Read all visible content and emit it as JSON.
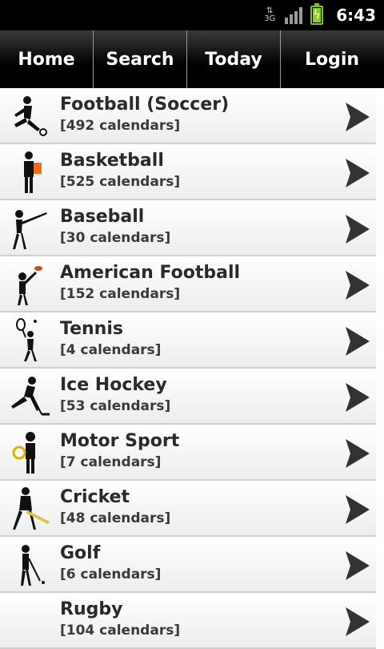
{
  "status": {
    "time": "6:43",
    "network": "3G",
    "icons": [
      "data-arrows-icon",
      "signal-icon",
      "battery-charging-icon"
    ]
  },
  "nav": [
    {
      "label": "Home"
    },
    {
      "label": "Search"
    },
    {
      "label": "Today"
    },
    {
      "label": "Login"
    }
  ],
  "sports": [
    {
      "title": "Football (Soccer)",
      "count": "[492 calendars]",
      "icon": "football-player-icon"
    },
    {
      "title": "Basketball",
      "count": "[525 calendars]",
      "icon": "basketball-player-icon"
    },
    {
      "title": "Baseball",
      "count": "[30 calendars]",
      "icon": "baseball-player-icon"
    },
    {
      "title": "American Football",
      "count": "[152 calendars]",
      "icon": "american-football-player-icon"
    },
    {
      "title": "Tennis",
      "count": "[4 calendars]",
      "icon": "tennis-player-icon"
    },
    {
      "title": "Ice Hockey",
      "count": "[53 calendars]",
      "icon": "hockey-player-icon"
    },
    {
      "title": "Motor Sport",
      "count": "[7 calendars]",
      "icon": "motorsport-driver-icon"
    },
    {
      "title": "Cricket",
      "count": "[48 calendars]",
      "icon": "cricket-player-icon"
    },
    {
      "title": "Golf",
      "count": "[6 calendars]",
      "icon": "golf-player-icon"
    },
    {
      "title": "Rugby",
      "count": "[104 calendars]",
      "icon": "rugby-player-icon"
    }
  ],
  "colors": {
    "navbar": "#000000",
    "accent_icon": "#f06a1e",
    "battery": "#8ccf2a",
    "cricket_bat": "#e0c040"
  }
}
